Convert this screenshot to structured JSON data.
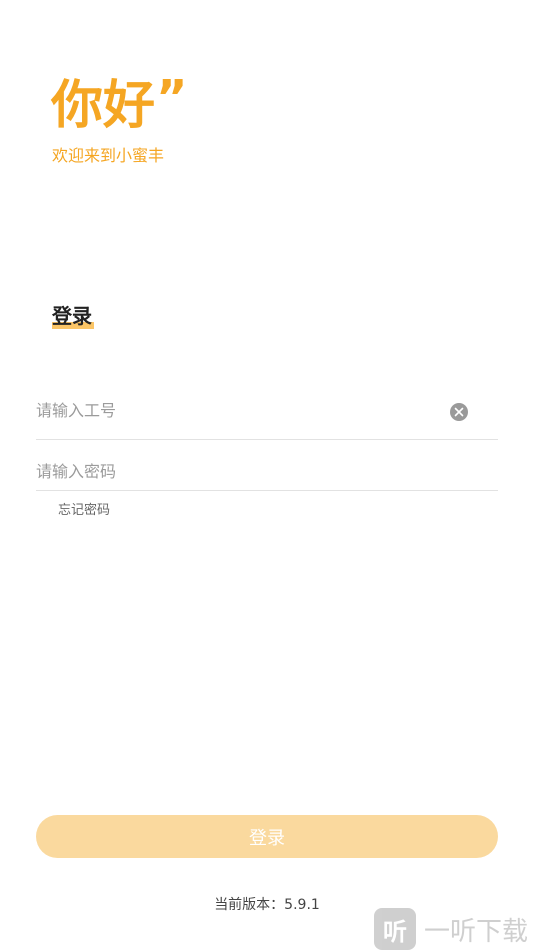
{
  "header": {
    "greeting": "你好",
    "greeting_mark": "”",
    "subtitle": "欢迎来到小蜜丰"
  },
  "login_section": {
    "title": "登录"
  },
  "form": {
    "employee_id_placeholder": "请输入工号",
    "employee_id_value": "",
    "password_placeholder": "请输入密码",
    "password_value": "",
    "forgot_password": "忘记密码",
    "clear_icon": "clear-circle-icon"
  },
  "login_button": {
    "label": "登录"
  },
  "footer": {
    "version_text": "当前版本：5.9.1"
  },
  "watermark": {
    "badge_char": "听",
    "text": "一听下载"
  },
  "colors": {
    "brand": "#F5A623",
    "button_bg": "#FAD99E",
    "title_underline": "#FBC566"
  }
}
